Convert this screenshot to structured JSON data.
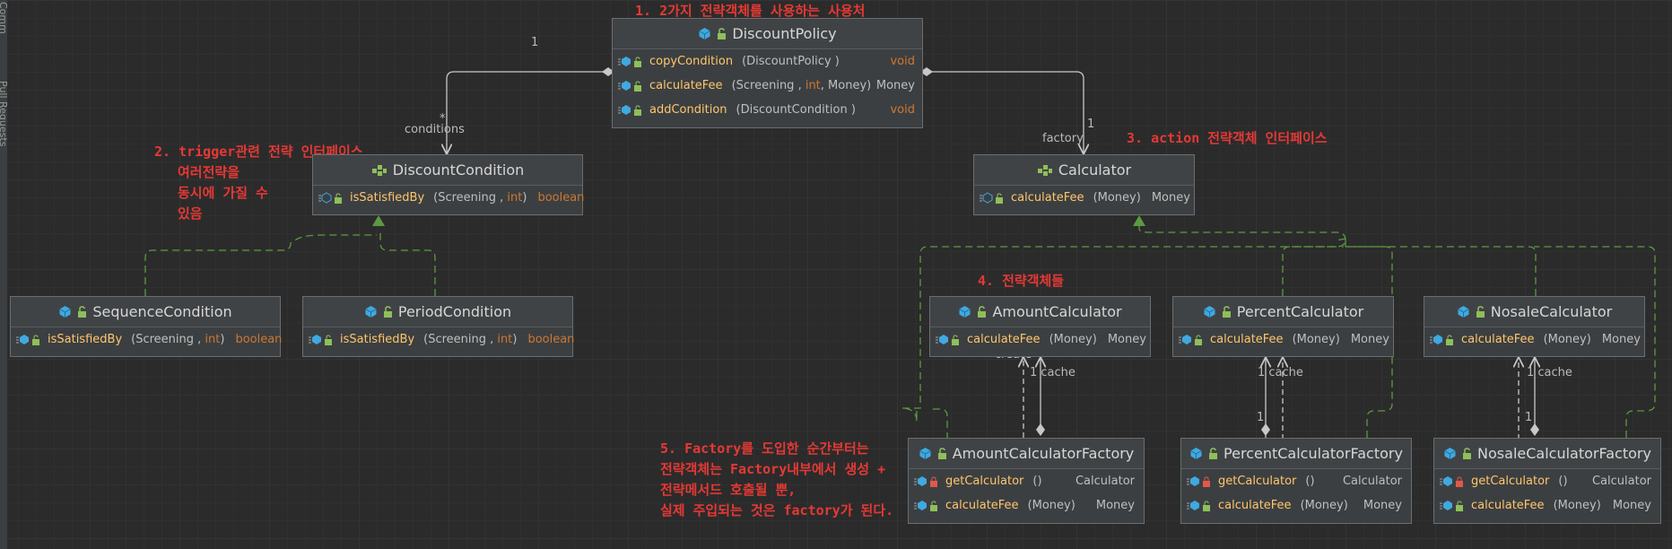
{
  "sidebar": {
    "tab1": "Comm",
    "tab2": "Pull Requests"
  },
  "colors": {
    "background": "#2b2b2b",
    "box": "#3c3f41",
    "method": "#ffc66d",
    "keyword": "#cc7832",
    "note": "#e53935",
    "impl": "#5c9a42"
  },
  "notes": {
    "n1": "1. 2가지 전략객체를 사용하는 사용처",
    "n2": [
      "2. trigger관련 전략 인터페이스",
      "여러전략을",
      "동시에 가질 수",
      "있음"
    ],
    "n3": "3. action 전략객체 인터페이스",
    "n4": "4. 전략객체들",
    "n5": [
      "5. Factory를 도입한 순간부터는",
      "전략객체는 Factory내부에서 생성 +",
      "전략메서드 호출될 뿐,",
      "실제 주입되는 것은 factory가 된다."
    ]
  },
  "labels": {
    "one_policy": "1",
    "star": "*",
    "conditions": "conditions",
    "one_factory": "1",
    "factory": "factory",
    "create": "«create»",
    "cache": "1 cache",
    "one": "1"
  },
  "classes": {
    "policy": {
      "name": "DiscountPolicy",
      "methods": [
        {
          "name": "copyCondition",
          "params": "(DiscountPolicy )",
          "ret": "void"
        },
        {
          "name": "calculateFee",
          "params": "(Screening , int, Money)",
          "ret": "Money"
        },
        {
          "name": "addCondition",
          "params": "(DiscountCondition  )",
          "ret": "void"
        }
      ]
    },
    "condition": {
      "name": "DiscountCondition",
      "methods": [
        {
          "name": "isSatisfiedBy",
          "params": "(Screening , int)",
          "ret": "boolean"
        }
      ]
    },
    "calculator": {
      "name": "Calculator",
      "methods": [
        {
          "name": "calculateFee",
          "params": "(Money)",
          "ret": "Money"
        }
      ]
    },
    "sequence": {
      "name": "SequenceCondition",
      "methods": [
        {
          "name": "isSatisfiedBy",
          "params": "(Screening , int)",
          "ret": "boolean"
        }
      ]
    },
    "period": {
      "name": "PeriodCondition",
      "methods": [
        {
          "name": "isSatisfiedBy",
          "params": "(Screening , int)",
          "ret": "boolean"
        }
      ]
    },
    "amount": {
      "name": "AmountCalculator",
      "methods": [
        {
          "name": "calculateFee",
          "params": "(Money)",
          "ret": "Money"
        }
      ]
    },
    "percent": {
      "name": "PercentCalculator",
      "methods": [
        {
          "name": "calculateFee",
          "params": "(Money)",
          "ret": "Money"
        }
      ]
    },
    "nosale": {
      "name": "NosaleCalculator",
      "methods": [
        {
          "name": "calculateFee",
          "params": "(Money)",
          "ret": "Money"
        }
      ]
    },
    "amountFactory": {
      "name": "AmountCalculatorFactory",
      "methods": [
        {
          "name": "getCalculator",
          "params": "()",
          "ret": "Calculator"
        },
        {
          "name": "calculateFee",
          "params": "(Money)",
          "ret": "Money"
        }
      ]
    },
    "percentFactory": {
      "name": "PercentCalculatorFactory",
      "methods": [
        {
          "name": "getCalculator",
          "params": "()",
          "ret": "Calculator"
        },
        {
          "name": "calculateFee",
          "params": "(Money)",
          "ret": "Money"
        }
      ]
    },
    "nosaleFactory": {
      "name": "NosaleCalculatorFactory",
      "methods": [
        {
          "name": "getCalculator",
          "params": "()",
          "ret": "Calculator"
        },
        {
          "name": "calculateFee",
          "params": "(Money)",
          "ret": "Money"
        }
      ]
    }
  }
}
